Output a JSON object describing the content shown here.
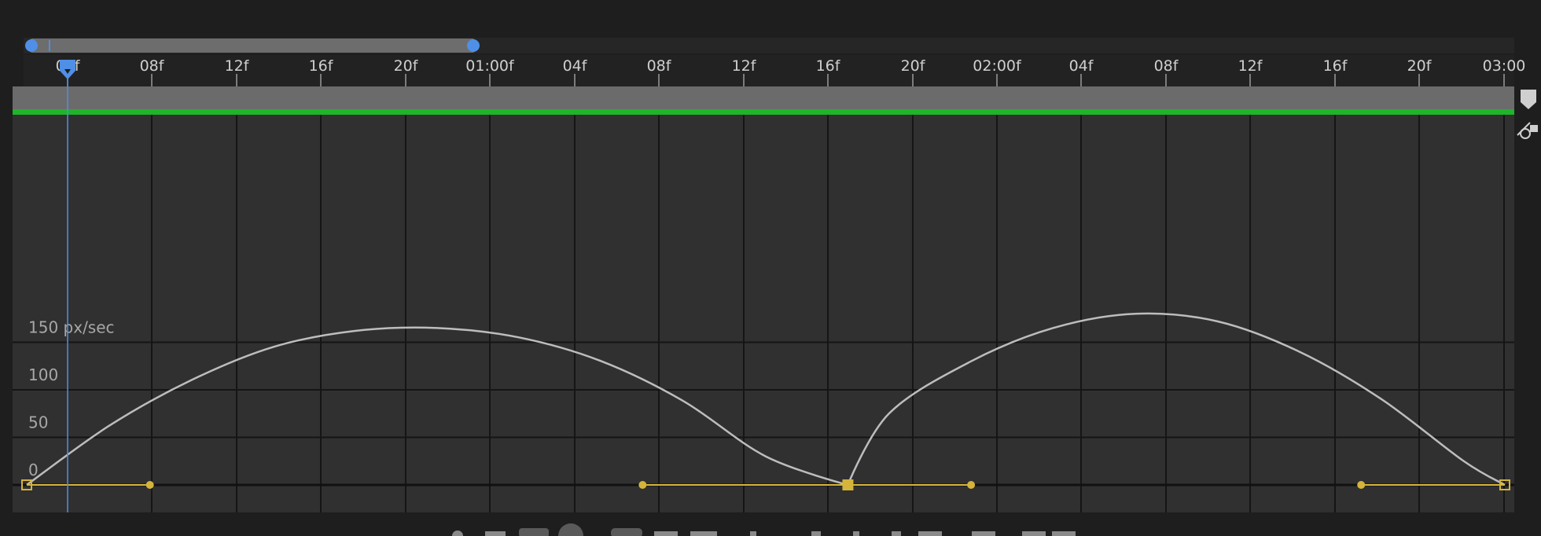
{
  "ruler": {
    "ticks": [
      "00f",
      "08f",
      "12f",
      "16f",
      "20f",
      "01:00f",
      "04f",
      "08f",
      "12f",
      "16f",
      "20f",
      "02:00f",
      "04f",
      "08f",
      "12f",
      "16f",
      "20f",
      "03:00"
    ]
  },
  "y_axis": {
    "labels": [
      "0",
      "50",
      "100",
      "150 px/sec"
    ]
  },
  "colors": {
    "background": "#1e1e1e",
    "graph_bg": "#303030",
    "grid": "#151515",
    "curve": "#bdbdbd",
    "keyframe": "#d4b43a",
    "playhead": "#4f8fe6",
    "work_area": "#1fb52a"
  },
  "icons": {
    "playhead": "playhead-marker-icon",
    "snapshot": "snapshot-icon",
    "keyframe_tool": "keyframe-tool-icon"
  },
  "chart_data": {
    "type": "line",
    "title": "",
    "xlabel": "",
    "ylabel": "px/sec",
    "unit": "px/sec",
    "x_unit": "frames (24 fps)",
    "xlim": [
      0,
      72
    ],
    "ylim": [
      0,
      190
    ],
    "grid": true,
    "current_time": "00f",
    "series": [
      {
        "x": [
          0,
          4,
          8,
          12,
          16,
          20,
          24,
          28,
          32,
          36,
          40,
          42,
          46,
          50,
          54,
          58,
          62,
          66,
          70,
          72
        ],
        "y": [
          0,
          62,
          110,
          145,
          162,
          165,
          155,
          130,
          88,
          30,
          0,
          75,
          130,
          165,
          180,
          172,
          140,
          90,
          25,
          0
        ]
      }
    ],
    "keyframes": [
      {
        "x": 0,
        "y": 0
      },
      {
        "x": 40,
        "y": 0
      },
      {
        "x": 72,
        "y": 0
      }
    ],
    "handles": [
      {
        "x": 6,
        "y": 0
      },
      {
        "x": 30,
        "y": 0
      },
      {
        "x": 46,
        "y": 0
      },
      {
        "x": 65,
        "y": 0
      }
    ]
  }
}
